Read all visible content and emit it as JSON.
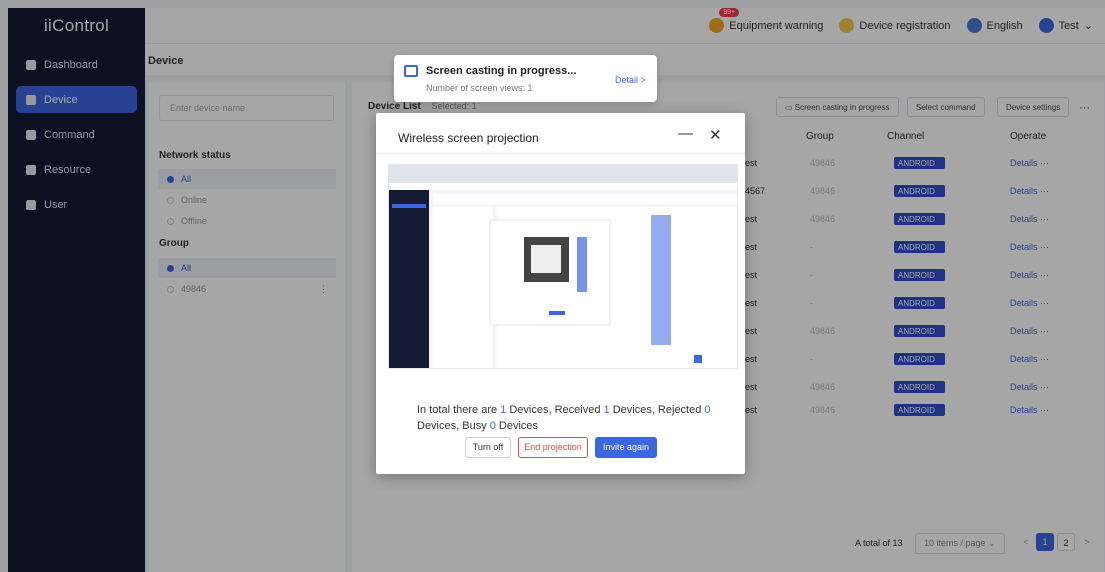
{
  "app": {
    "name": "iiControl"
  },
  "sidebar": {
    "items": [
      {
        "label": "Dashboard"
      },
      {
        "label": "Device"
      },
      {
        "label": "Command"
      },
      {
        "label": "Resource"
      },
      {
        "label": "User"
      }
    ]
  },
  "topbar": {
    "badge": "99+",
    "warning": "Equipment warning",
    "registration": "Device registration",
    "language": "English",
    "user": "Test"
  },
  "page": {
    "title": "Device"
  },
  "filters": {
    "search_placeholder": "Enter device name",
    "network_status": "Network status",
    "status_options": [
      "All",
      "Online",
      "Offline"
    ],
    "group_label": "Group",
    "group_options": [
      "All",
      "49846"
    ]
  },
  "list": {
    "title": "Device List",
    "selected": "Selected: 1",
    "buttons": {
      "casting": "Screen casting in progress",
      "select_command": "Select command",
      "settings": "Device settings",
      "more": "···"
    },
    "columns": {
      "group": "Group",
      "channel": "Channel",
      "operate": "Operate"
    },
    "rows": [
      {
        "name": "est",
        "group": "49846",
        "channel": "ANDROID",
        "op": "Details ···"
      },
      {
        "name": "4567",
        "group": "49846",
        "channel": "ANDROID",
        "op": "Details ···"
      },
      {
        "name": "est",
        "group": "49846",
        "channel": "ANDROID",
        "op": "Details ···"
      },
      {
        "name": "est",
        "group": "-",
        "channel": "ANDROID",
        "op": "Details ···"
      },
      {
        "name": "est",
        "group": "-",
        "channel": "ANDROID",
        "op": "Details ···"
      },
      {
        "name": "est",
        "group": "-",
        "channel": "ANDROID",
        "op": "Details ···"
      },
      {
        "name": "est",
        "group": "49846",
        "channel": "ANDROID",
        "op": "Details ···"
      },
      {
        "name": "est",
        "group": "-",
        "channel": "ANDROID",
        "op": "Details ···"
      },
      {
        "name": "est",
        "group": "49846",
        "channel": "ANDROID",
        "op": "Details ···"
      },
      {
        "name": "est",
        "group": "49846",
        "channel": "ANDROID",
        "op": "Details ···"
      }
    ],
    "pagination": {
      "total": "A total of 13",
      "per_page": "10 items / page",
      "pages": [
        "1",
        "2"
      ],
      "prev": "<",
      "next": ">"
    }
  },
  "toast": {
    "title": "Screen casting in progress...",
    "subtitle": "Number of screen views: 1",
    "link": "Detail >"
  },
  "modal": {
    "title": "Wireless screen projection",
    "minimize": "—",
    "close": "✕",
    "summary": {
      "part1": "In total there are ",
      "total": "1",
      "part2": " Devices,  Received ",
      "received": "1",
      "part3": " Devices,  Rejected ",
      "rejected": "0",
      "part4": " Devices,  Busy ",
      "busy": "0",
      "part5": " Devices"
    },
    "buttons": {
      "turn_off": "Turn off",
      "end": "End projection",
      "invite": "Invite again"
    }
  },
  "colors": {
    "primary": "#3c66e2",
    "sidebar": "#141a33",
    "danger": "#f2404d"
  }
}
